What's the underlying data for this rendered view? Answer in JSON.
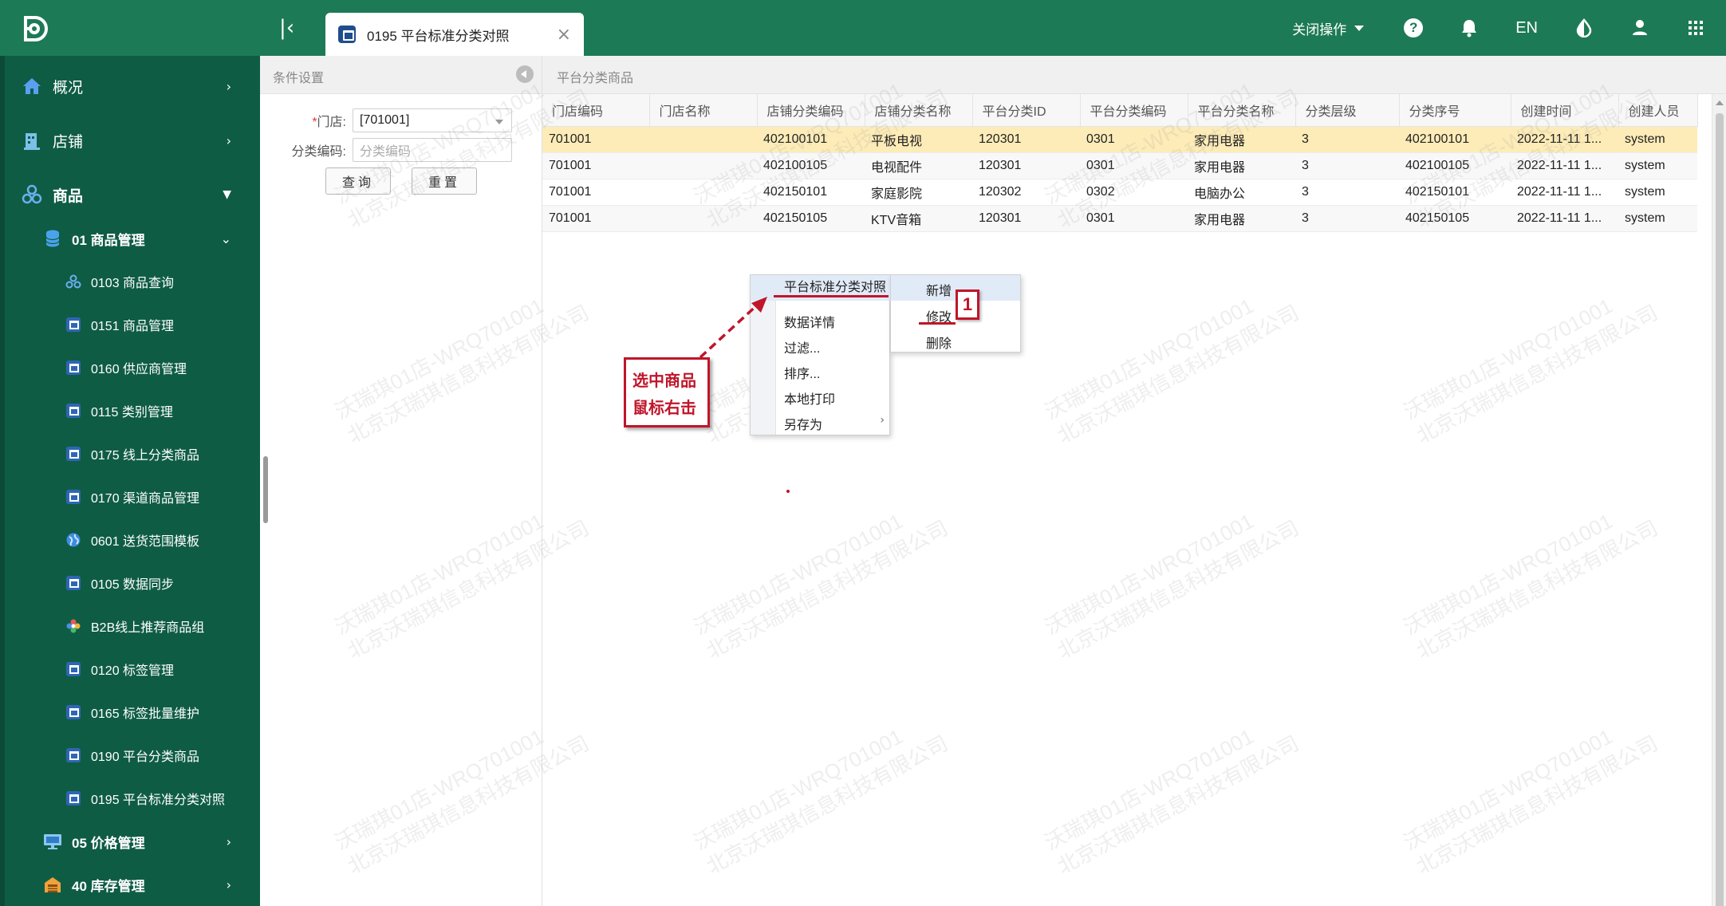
{
  "topbar": {
    "tab_label": "0195 平台标准分类对照",
    "close_ops_label": "关闭操作",
    "lang_label": "EN",
    "help_label": "?"
  },
  "sidebar": {
    "items": [
      {
        "label": "概况",
        "level": 1,
        "icon": "home-icon"
      },
      {
        "label": "店铺",
        "level": 1,
        "icon": "shop-icon"
      },
      {
        "label": "商品",
        "level": 1,
        "icon": "goods-icon"
      },
      {
        "label": "01 商品管理",
        "level": 2,
        "icon": "database-icon"
      },
      {
        "label": "0103 商品查询",
        "level": 3,
        "icon": "cluster-icon"
      },
      {
        "label": "0151 商品管理",
        "level": 3,
        "icon": "cart-icon"
      },
      {
        "label": "0160 供应商管理",
        "level": 3,
        "icon": "cart-icon"
      },
      {
        "label": "0115 类别管理",
        "level": 3,
        "icon": "cart-icon"
      },
      {
        "label": "0175 线上分类商品",
        "level": 3,
        "icon": "cart-icon"
      },
      {
        "label": "0170 渠道商品管理",
        "level": 3,
        "icon": "cart-icon"
      },
      {
        "label": "0601 送货范围模板",
        "level": 3,
        "icon": "globe-icon"
      },
      {
        "label": "0105 数据同步",
        "level": 3,
        "icon": "cart-icon"
      },
      {
        "label": "B2B线上推荐商品组",
        "level": 3,
        "icon": "flower-icon"
      },
      {
        "label": "0120 标签管理",
        "level": 3,
        "icon": "cart-icon"
      },
      {
        "label": "0165 标签批量维护",
        "level": 3,
        "icon": "cart-icon"
      },
      {
        "label": "0190 平台分类商品",
        "level": 3,
        "icon": "cart-icon"
      },
      {
        "label": "0195 平台标准分类对照",
        "level": 3,
        "icon": "cart-icon"
      },
      {
        "label": "05 价格管理",
        "level": 2,
        "icon": "monitor-icon"
      },
      {
        "label": "40 库存管理",
        "level": 2,
        "icon": "warehouse-icon"
      }
    ]
  },
  "condition": {
    "title": "条件设置",
    "store_label": "门店:",
    "store_required": "*",
    "store_value": "[701001]",
    "code_label": "分类编码:",
    "code_placeholder": "分类编码",
    "query_button": "查询",
    "reset_button": "重置"
  },
  "grid": {
    "title": "平台分类商品",
    "columns": [
      "门店编码",
      "门店名称",
      "店铺分类编码",
      "店铺分类名称",
      "平台分类ID",
      "平台分类编码",
      "平台分类名称",
      "分类层级",
      "分类序号",
      "创建时间",
      "创建人员"
    ],
    "rows": [
      [
        "701001",
        "",
        "402100101",
        "平板电视",
        "120301",
        "0301",
        "家用电器",
        "3",
        "402100101",
        "2022-11-11 1...",
        "system"
      ],
      [
        "701001",
        "",
        "402100105",
        "电视配件",
        "120301",
        "0301",
        "家用电器",
        "3",
        "402100105",
        "2022-11-11 1...",
        "system"
      ],
      [
        "701001",
        "",
        "402150101",
        "家庭影院",
        "120302",
        "0302",
        "电脑办公",
        "3",
        "402150101",
        "2022-11-11 1...",
        "system"
      ],
      [
        "701001",
        "",
        "402150105",
        "KTV音箱",
        "120301",
        "0301",
        "家用电器",
        "3",
        "402150105",
        "2022-11-11 1...",
        "system"
      ]
    ]
  },
  "context_menu": {
    "items": [
      "平台标准分类对照",
      "数据详情",
      "过滤...",
      "排序...",
      "本地打印",
      "另存为"
    ],
    "submenu": [
      "新增",
      "修改",
      "删除"
    ]
  },
  "annotations": {
    "step_number": "1",
    "callout_line1": "选中商品",
    "callout_line2": "鼠标右击"
  },
  "watermark": {
    "line1": "沃瑞琪01店-WRQ701001",
    "line2": "北京沃瑞琪信息科技有限公司"
  },
  "colors": {
    "brand_green": "#1d7a56",
    "sidebar_green": "#0f5c45",
    "selected_row": "#fdecb8",
    "annotation_red": "#c0152a"
  }
}
